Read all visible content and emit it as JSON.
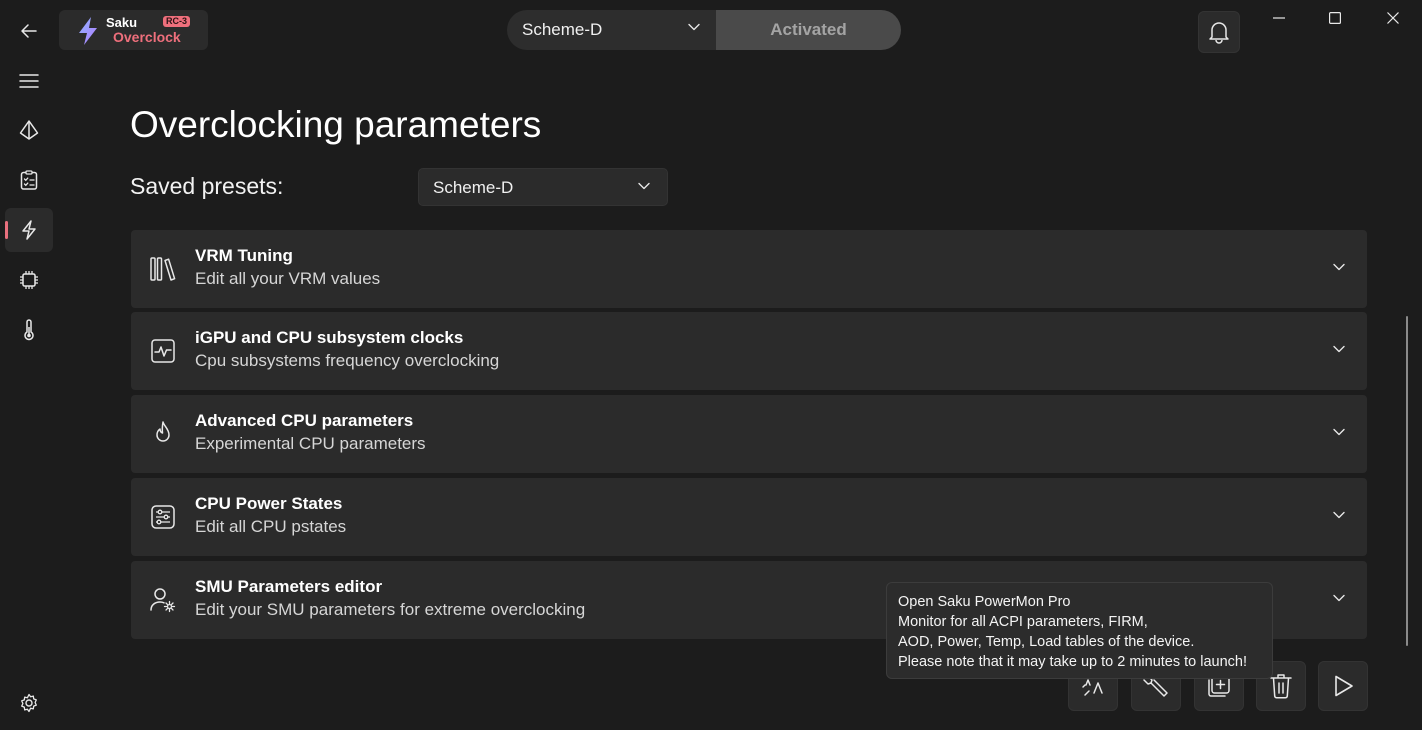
{
  "app": {
    "logo_top": "Saku",
    "logo_badge": "RC-3",
    "logo_bottom": "Overclock"
  },
  "header": {
    "scheme_selected": "Scheme-D",
    "activated_label": "Activated"
  },
  "page": {
    "title": "Overclocking parameters",
    "saved_presets_label": "Saved presets:",
    "saved_presets_value": "Scheme-D"
  },
  "sections": [
    {
      "title": "VRM Tuning",
      "subtitle": "Edit all your VRM values",
      "icon": "books-icon"
    },
    {
      "title": "iGPU and CPU subsystem clocks",
      "subtitle": "Cpu subsystems frequency overclocking",
      "icon": "pulse-monitor-icon"
    },
    {
      "title": "Advanced CPU parameters",
      "subtitle": "Experimental CPU parameters",
      "icon": "flame-icon"
    },
    {
      "title": "CPU Power States",
      "subtitle": "Edit all CPU pstates",
      "icon": "sliders-list-icon"
    },
    {
      "title": "SMU Parameters editor",
      "subtitle": "Edit your SMU parameters for extreme overclocking",
      "icon": "user-gear-icon"
    }
  ],
  "tooltip": {
    "line1": "Open Saku PowerMon Pro",
    "line2": "Monitor for all ACPI parameters, FIRM,",
    "line3": "AOD, Power, Temp, Load tables of the device.",
    "line4": "Please note that it may take up to 2 minutes to launch!"
  },
  "colors": {
    "background": "#1c1c1c",
    "card": "#2b2b2b",
    "accent": "#ee6f7c",
    "activated_bg": "#4a4a4a"
  }
}
